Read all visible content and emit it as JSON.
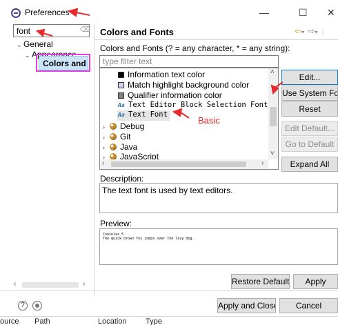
{
  "window": {
    "title": "Preferences",
    "controls": [
      "—",
      "☐",
      "✕"
    ]
  },
  "left": {
    "filter_value": "font",
    "tree": [
      {
        "label": "General",
        "expanded": true
      },
      {
        "label": "Appearance",
        "expanded": true
      },
      {
        "label": "Colors and Fonts",
        "selected": true
      }
    ]
  },
  "header": {
    "title": "Colors and Fonts"
  },
  "main": {
    "filter_label": "Colors and Fonts (? = any character, * = any string):",
    "filter_placeholder": "type filter text",
    "tree_items": [
      {
        "label": "Information text color",
        "kind": "color",
        "color": "#000000"
      },
      {
        "label": "Match highlight background color",
        "kind": "color",
        "color": "#cfd1f0"
      },
      {
        "label": "Qualifier information color",
        "kind": "color",
        "color": "#808080"
      },
      {
        "label": "Text Editor Block Selection Font",
        "kind": "font"
      },
      {
        "label": "Text Font",
        "kind": "font",
        "selected": true
      },
      {
        "label": "Debug",
        "kind": "category"
      },
      {
        "label": "Git",
        "kind": "category"
      },
      {
        "label": "Java",
        "kind": "category"
      },
      {
        "label": "JavaScript",
        "kind": "category"
      }
    ],
    "font_icon_text": "Aa",
    "buttons": {
      "edit": "Edit...",
      "use_system_font": "Use System Font",
      "reset": "Reset",
      "edit_default": "Edit Default...",
      "go_to_default": "Go to Default",
      "expand_all": "Expand All"
    },
    "description_title": "Description:",
    "description_text": "The text font is used by text editors.",
    "preview_title": "Preview:",
    "preview_lines": [
      "Consolas 5",
      "The quick brown fox jumps over the lazy dog."
    ],
    "restore_defaults": "Restore Defaults",
    "apply": "Apply"
  },
  "footer": {
    "help_icon": "?",
    "apply_and_close": "Apply and Close",
    "cancel": "Cancel"
  },
  "annotation": {
    "label": "Basic",
    "color": "#e52b2b",
    "highlight_color": "#e040e0"
  },
  "background_fragments": {
    "left_code_1": "in",
    "left_code_2": "me",
    "bottom_tabs": [
      "ource",
      "Path",
      "Location",
      "Type"
    ]
  }
}
